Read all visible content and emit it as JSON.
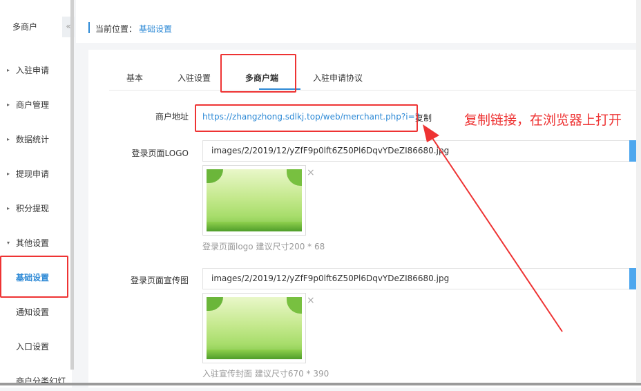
{
  "sidebar": {
    "title": "多商户",
    "collapse_icon": "«",
    "items": [
      {
        "label": "入驻申请",
        "caret": "▸"
      },
      {
        "label": "商户管理",
        "caret": "▸"
      },
      {
        "label": "数据统计",
        "caret": "▸"
      },
      {
        "label": "提现申请",
        "caret": "▸"
      },
      {
        "label": "积分提现",
        "caret": "▸"
      },
      {
        "label": "其他设置",
        "caret": "▾"
      },
      {
        "label": "基础设置",
        "caret": ""
      },
      {
        "label": "通知设置",
        "caret": ""
      },
      {
        "label": "入口设置",
        "caret": ""
      },
      {
        "label": "商户分类幻灯",
        "caret": ""
      }
    ]
  },
  "breadcrumb": {
    "label": "当前位置：",
    "current": "基础设置"
  },
  "tabs": [
    "基本",
    "入驻设置",
    "多商户端",
    "入驻申请协议"
  ],
  "form": {
    "merchant_address_label": "商户地址",
    "merchant_address_link": "https://zhangzhong.sdlkj.top/web/merchant.php?i=2",
    "copy_label": "复制",
    "logo_label": "登录页面LOGO",
    "logo_value": "images/2/2019/12/yZfF9p0lft6Z50Pl6DqvYDeZI86680.jpg",
    "logo_hint": "登录页面logo 建议尺寸200 * 68",
    "promo_label": "登录页面宣传图",
    "promo_value": "images/2/2019/12/yZfF9p0lft6Z50Pl6DqvYDeZI86680.jpg",
    "promo_hint": "入驻宣传封面 建议尺寸670 * 390",
    "close_icon": "×"
  },
  "annotation": {
    "text": "复制链接，在浏览器上打开"
  }
}
